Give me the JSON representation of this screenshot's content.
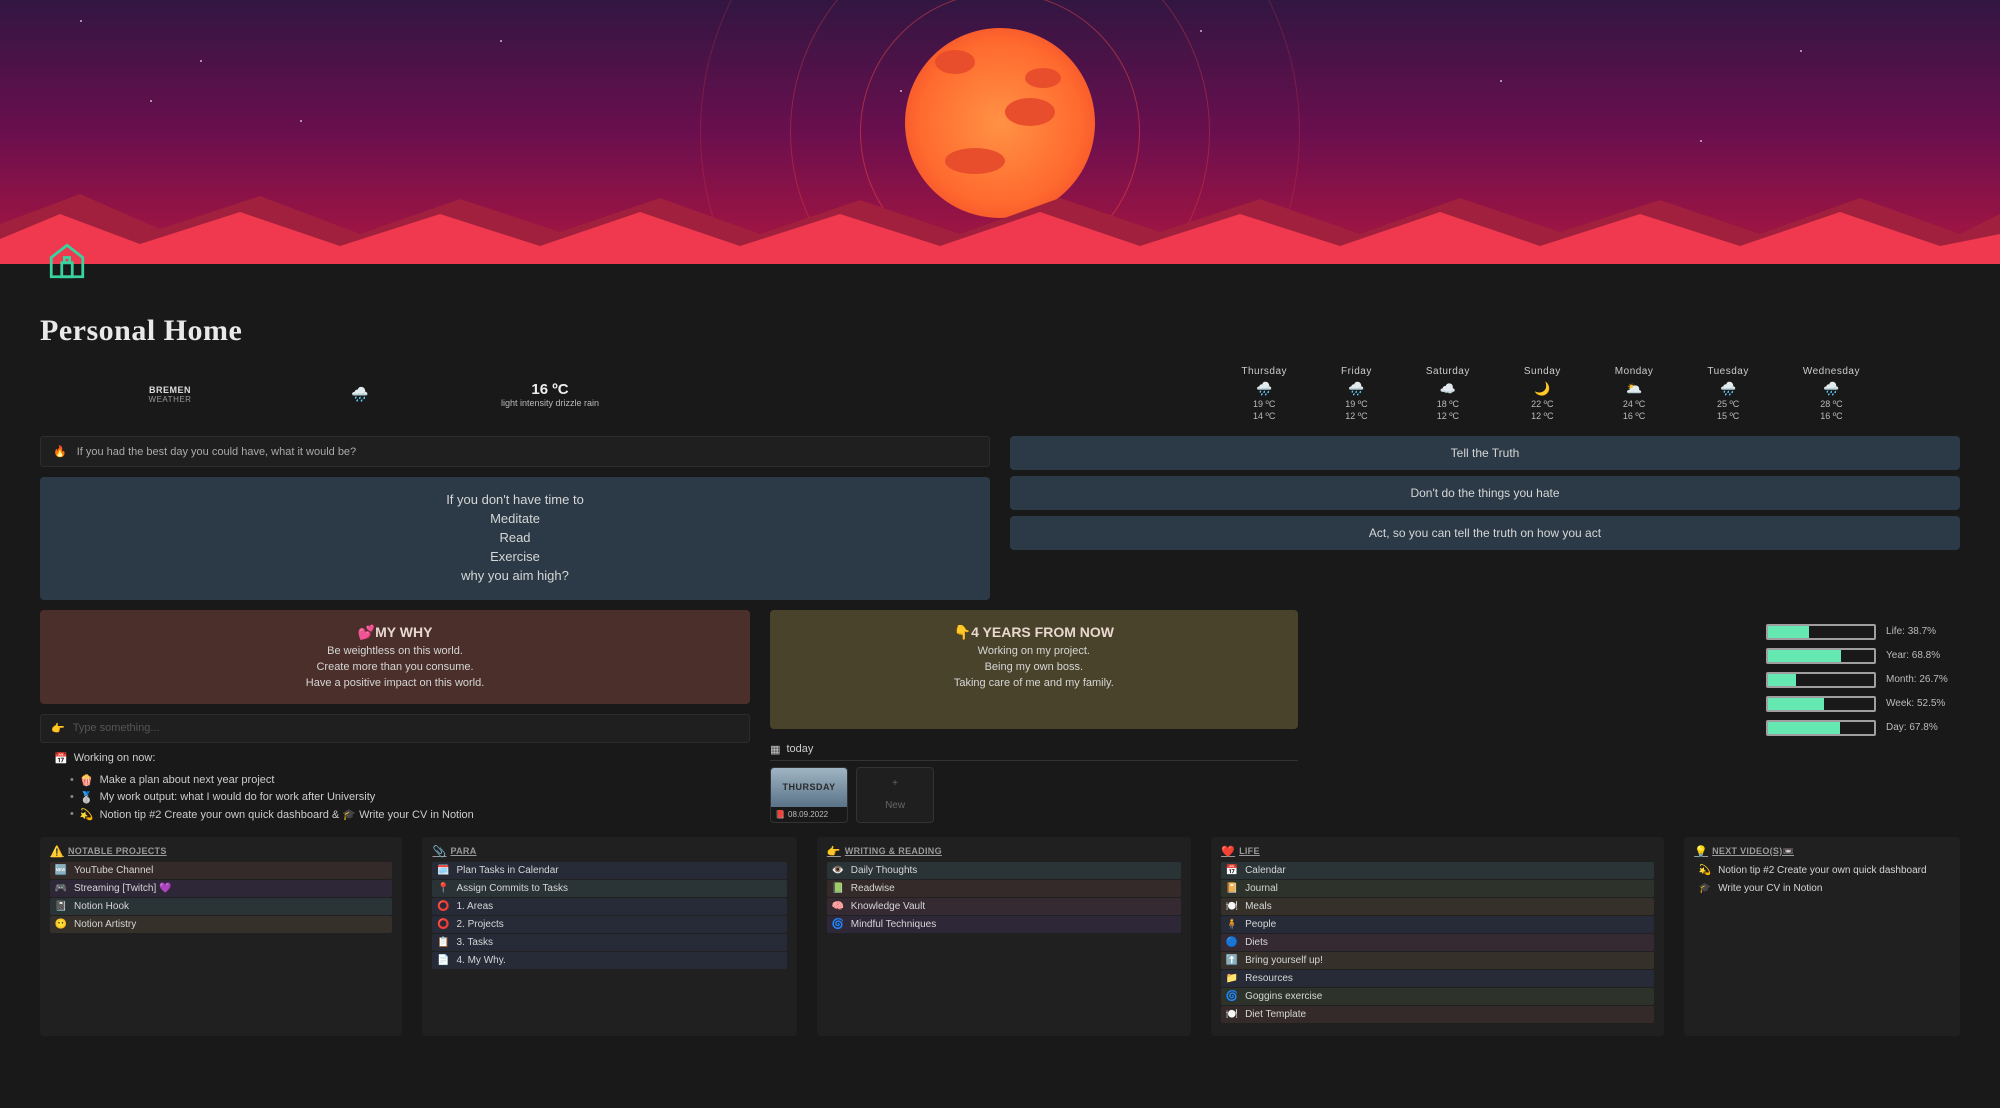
{
  "page": {
    "title": "Personal Home"
  },
  "weather": {
    "city": "BREMEN",
    "subtitle": "WEATHER",
    "current_icon": "🌧️",
    "current_temp": "16 ºC",
    "current_desc": "light intensity drizzle rain",
    "forecast": [
      {
        "day": "Thursday",
        "icon": "🌧️",
        "hi": "19 ºC",
        "lo": "14 ºC"
      },
      {
        "day": "Friday",
        "icon": "🌧️",
        "hi": "19 ºC",
        "lo": "12 ºC"
      },
      {
        "day": "Saturday",
        "icon": "☁️",
        "hi": "18 ºC",
        "lo": "12 ºC"
      },
      {
        "day": "Sunday",
        "icon": "🌙",
        "hi": "22 ºC",
        "lo": "12 ºC"
      },
      {
        "day": "Monday",
        "icon": "🌥️",
        "hi": "24 ºC",
        "lo": "16 ºC"
      },
      {
        "day": "Tuesday",
        "icon": "🌧️",
        "hi": "25 ºC",
        "lo": "15 ºC"
      },
      {
        "day": "Wednesday",
        "icon": "🌧️",
        "hi": "28 ºC",
        "lo": "16 ºC"
      }
    ]
  },
  "prompts": {
    "fire_icon": "🔥",
    "fire_text": "If you had the best day you could have, what it would be?",
    "med_l1": "If you don't have time to",
    "med_l2": "Meditate",
    "med_l3": "Read",
    "med_l4": "Exercise",
    "med_l5": "why you aim high?",
    "q1": "Tell the Truth",
    "q2": "Don't do the things you hate",
    "q3": "Act, so you can tell the truth on how you act"
  },
  "why": {
    "title": "💕MY WHY",
    "l1": "Be weightless on this world.",
    "l2": "Create more than you consume.",
    "l3": "Have a positive impact on this world."
  },
  "future": {
    "title": "👇4 YEARS FROM NOW",
    "l1": "Working on my project.",
    "l2": "Being my own boss.",
    "l3": "Taking care of me and my family."
  },
  "editor": {
    "type_icon": "👉",
    "type_placeholder": "Type something...",
    "now_icon": "📅",
    "now_label": "Working on now:",
    "bullets": [
      {
        "icon": "🍿",
        "text": "Make a plan about next year project"
      },
      {
        "icon": "🥈",
        "text": "My work output: what I would do for work after University"
      },
      {
        "icon": "💫",
        "text": "Notion tip #2 Create your own quick dashboard & 🎓 Write your CV in Notion"
      }
    ]
  },
  "gallery": {
    "tab_icon": "▦",
    "tab_label": "today",
    "card_thumb_text": "THURSDAY",
    "card_date_icon": "📕",
    "card_date": "08.09.2022",
    "new_icon": "+",
    "new_label": "New"
  },
  "progress": [
    {
      "label": "Life: 38.7%",
      "pct": 38.7
    },
    {
      "label": "Year: 68.8%",
      "pct": 68.8
    },
    {
      "label": "Month: 26.7%",
      "pct": 26.7
    },
    {
      "label": "Week: 52.5%",
      "pct": 52.5
    },
    {
      "label": "Day: 67.8%",
      "pct": 67.8
    }
  ],
  "blocks": {
    "notable": {
      "icon": "⚠️",
      "title": "NOTABLE PROJECTS",
      "items": [
        {
          "icon": "🆕",
          "text": "YouTube Channel"
        },
        {
          "icon": "🎮",
          "text": "Streaming [Twitch] 💜"
        },
        {
          "icon": "📓",
          "text": "Notion Hook"
        },
        {
          "icon": "😶",
          "text": "Notion Artistry"
        }
      ]
    },
    "para": {
      "icon": "📎",
      "title": "PARA",
      "items": [
        {
          "icon": "🗓️",
          "text": "Plan Tasks in Calendar"
        },
        {
          "icon": "📍",
          "text": "Assign Commits to Tasks"
        },
        {
          "icon": "⭕",
          "text": "1. Areas"
        },
        {
          "icon": "⭕",
          "text": "2. Projects"
        },
        {
          "icon": "📋",
          "text": "3. Tasks"
        },
        {
          "icon": "📄",
          "text": "4. My Why."
        }
      ]
    },
    "writing": {
      "icon": "👉",
      "title": "WRITING & READING",
      "items": [
        {
          "icon": "👁️",
          "text": "Daily Thoughts"
        },
        {
          "icon": "📗",
          "text": "Readwise"
        },
        {
          "icon": "🧠",
          "text": "Knowledge Vault"
        },
        {
          "icon": "🌀",
          "text": "Mindful Techniques"
        }
      ]
    },
    "life": {
      "icon": "❤️",
      "title": "LIFE",
      "items": [
        {
          "icon": "📅",
          "text": "Calendar"
        },
        {
          "icon": "📔",
          "text": "Journal"
        },
        {
          "icon": "🍽️",
          "text": "Meals"
        },
        {
          "icon": "🧍",
          "text": "People"
        },
        {
          "icon": "🔵",
          "text": "Diets"
        },
        {
          "icon": "⬆️",
          "text": "Bring yourself up!"
        },
        {
          "icon": "📁",
          "text": "Resources"
        },
        {
          "icon": "🌀",
          "text": "Goggins exercise"
        },
        {
          "icon": "🍽️",
          "text": "Diet Template"
        }
      ]
    },
    "next": {
      "icon": "💡",
      "title": "NEXT VIDEO(S)📼",
      "items": [
        {
          "icon": "💫",
          "text": "Notion tip #2 Create your own quick dashboard"
        },
        {
          "icon": "🎓",
          "text": "Write your CV in Notion"
        }
      ]
    }
  }
}
